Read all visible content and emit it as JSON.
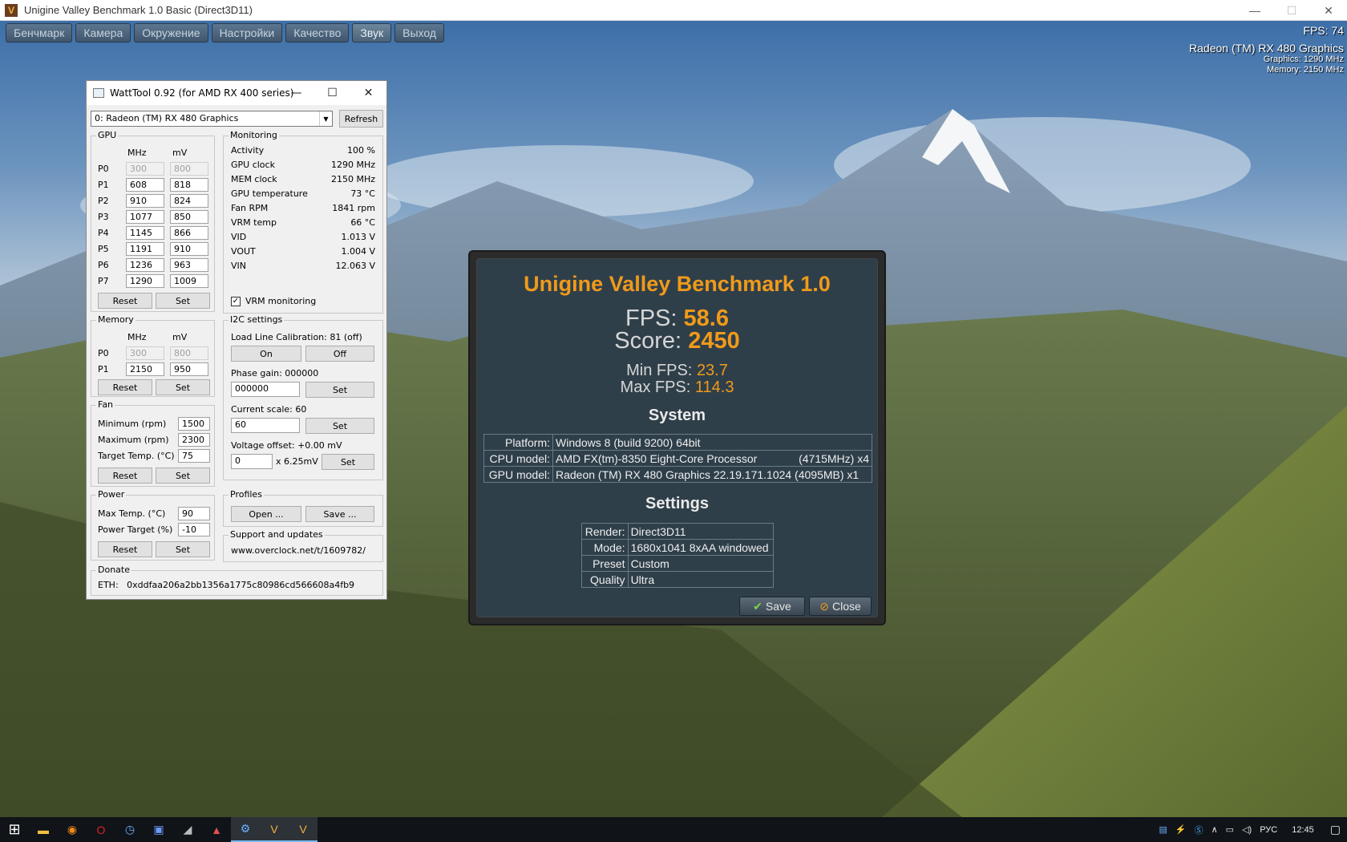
{
  "app": {
    "title": "Unigine Valley Benchmark 1.0 Basic (Direct3D11)",
    "icon_letter": "V",
    "window_controls": [
      "—",
      "☐",
      "✕"
    ]
  },
  "menu": {
    "items": [
      "Бенчмарк",
      "Камера",
      "Окружение",
      "Настройки",
      "Качество",
      "Звук",
      "Выход"
    ],
    "active": "Звук"
  },
  "hud": {
    "fps": "FPS: 74",
    "gpu_name": "Radeon (TM) RX 480 Graphics",
    "graphics_clock": "Graphics: 1290 MHz",
    "memory_clock": "Memory: 2150 MHz"
  },
  "watttool": {
    "title": "WattTool 0.92 (for AMD RX 400 series)",
    "gpu_select": "0: Radeon (TM) RX 480 Graphics",
    "refresh_label": "Refresh",
    "gpu": {
      "label": "GPU",
      "col_mhz": "MHz",
      "col_mv": "mV",
      "rows": [
        {
          "p": "P0",
          "mhz": "300",
          "mv": "800",
          "disabled": true
        },
        {
          "p": "P1",
          "mhz": "608",
          "mv": "818"
        },
        {
          "p": "P2",
          "mhz": "910",
          "mv": "824"
        },
        {
          "p": "P3",
          "mhz": "1077",
          "mv": "850"
        },
        {
          "p": "P4",
          "mhz": "1145",
          "mv": "866"
        },
        {
          "p": "P5",
          "mhz": "1191",
          "mv": "910"
        },
        {
          "p": "P6",
          "mhz": "1236",
          "mv": "963"
        },
        {
          "p": "P7",
          "mhz": "1290",
          "mv": "1009"
        }
      ],
      "reset": "Reset",
      "set": "Set"
    },
    "memory": {
      "label": "Memory",
      "col_mhz": "MHz",
      "col_mv": "mV",
      "rows": [
        {
          "p": "P0",
          "mhz": "300",
          "mv": "800",
          "disabled": true
        },
        {
          "p": "P1",
          "mhz": "2150",
          "mv": "950"
        }
      ],
      "reset": "Reset",
      "set": "Set"
    },
    "fan": {
      "label": "Fan",
      "min_label": "Minimum (rpm)",
      "min": "1500",
      "max_label": "Maximum (rpm)",
      "max": "2300",
      "target_label": "Target Temp. (°C)",
      "target": "75",
      "reset": "Reset",
      "set": "Set"
    },
    "power": {
      "label": "Power",
      "maxtemp_label": "Max Temp. (°C)",
      "maxtemp": "90",
      "target_label": "Power Target (%)",
      "target": "-10",
      "reset": "Reset",
      "set": "Set"
    },
    "monitoring": {
      "label": "Monitoring",
      "rows": [
        {
          "k": "Activity",
          "v": "100 %"
        },
        {
          "k": "GPU clock",
          "v": "1290 MHz"
        },
        {
          "k": "MEM clock",
          "v": "2150 MHz"
        },
        {
          "k": "GPU temperature",
          "v": "73 °C"
        },
        {
          "k": "Fan RPM",
          "v": "1841 rpm"
        },
        {
          "k": "VRM temp",
          "v": "66 °C"
        },
        {
          "k": "VID",
          "v": "1.013 V"
        },
        {
          "k": "VOUT",
          "v": "1.004 V"
        },
        {
          "k": "VIN",
          "v": "12.063 V"
        }
      ],
      "vrm_label": "VRM monitoring",
      "vrm_checked": true
    },
    "i2c": {
      "label": "I2C settings",
      "llc": "Load Line Calibration: 81 (off)",
      "on": "On",
      "off": "Off",
      "phase_label": "Phase gain: 000000",
      "phase_value": "000000",
      "scale_label": "Current scale: 60",
      "scale_value": "60",
      "voffset_label": "Voltage offset: +0.00 mV",
      "voffset_value": "0",
      "voffset_unit": "x 6.25mV",
      "set": "Set"
    },
    "profiles": {
      "label": "Profiles",
      "open": "Open ...",
      "save": "Save ..."
    },
    "support": {
      "label": "Support and updates",
      "url": "www.overclock.net/t/1609782/"
    },
    "donate": {
      "label": "Donate",
      "eth": "ETH:   0xddfaa206a2bb1356a1775c80986cd566608a4fb9"
    }
  },
  "results": {
    "title": "Unigine Valley Benchmark 1.0",
    "fps_label": "FPS:",
    "fps": "58.6",
    "score_label": "Score:",
    "score": "2450",
    "min_label": "Min FPS:",
    "min": "23.7",
    "max_label": "Max FPS:",
    "max": "114.3",
    "system_heading": "System",
    "system": [
      {
        "k": "Platform:",
        "v": "Windows 8 (build 9200) 64bit",
        "extra": ""
      },
      {
        "k": "CPU model:",
        "v": "AMD FX(tm)-8350 Eight-Core Processor",
        "extra": "(4715MHz) x4"
      },
      {
        "k": "GPU model:",
        "v": "Radeon (TM) RX 480 Graphics 22.19.171.1024 (4095MB) x1",
        "extra": ""
      }
    ],
    "settings_heading": "Settings",
    "settings": [
      {
        "k": "Render:",
        "v": "Direct3D11"
      },
      {
        "k": "Mode:",
        "v": "1680x1041 8xAA windowed"
      },
      {
        "k": "Preset",
        "v": "Custom"
      },
      {
        "k": "Quality",
        "v": "Ultra"
      }
    ],
    "save_label": "Save",
    "close_label": "Close"
  },
  "taskbar": {
    "lang": "РУС",
    "time": "12:45"
  }
}
